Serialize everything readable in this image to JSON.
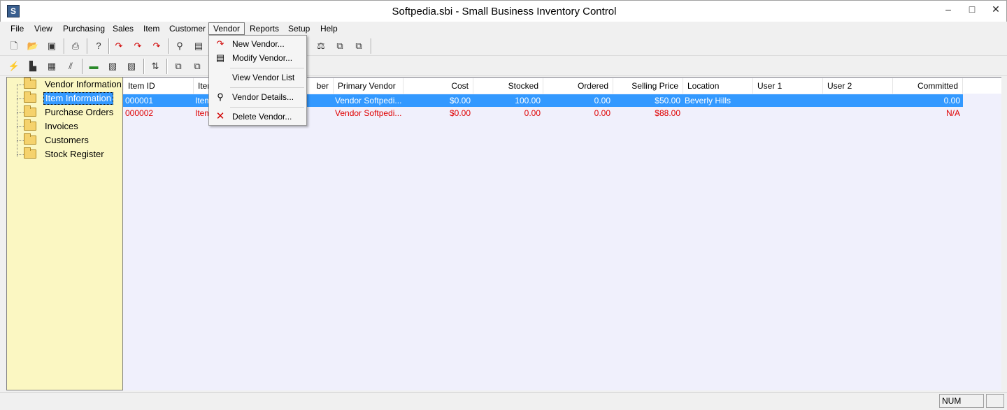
{
  "window": {
    "title": "Softpedia.sbi - Small Business Inventory Control",
    "app_icon": "S"
  },
  "window_controls": {
    "minimize": "–",
    "maximize": "□",
    "close": "✕"
  },
  "menubar": [
    "File",
    "View",
    "Purchasing",
    "Sales",
    "Item",
    "Customer",
    "Vendor",
    "Reports",
    "Setup",
    "Help"
  ],
  "toolbar1_icons": [
    "new-file-icon",
    "open-folder-icon",
    "open-db-icon",
    "print-icon",
    "help-icon",
    "receive-icon",
    "ship-icon",
    "return-icon",
    "find-icon",
    "report-icon",
    "scale-icon",
    "copy-icon",
    "copy-back-icon"
  ],
  "toolbar2_icons": [
    "bolt-icon",
    "truck-icon",
    "item-icon",
    "hatch-icon",
    "cash-icon",
    "adjust-icon",
    "transfer-icon",
    "sort-icon",
    "list-icon",
    "list-alt-icon"
  ],
  "tree": {
    "items": [
      {
        "label": "Vendor Information"
      },
      {
        "label": "Item Information"
      },
      {
        "label": "Purchase Orders"
      },
      {
        "label": "Invoices"
      },
      {
        "label": "Customers"
      },
      {
        "label": "Stock Register"
      }
    ],
    "selected": "Item Information"
  },
  "list": {
    "headers": [
      "Item ID",
      "Iter",
      "ber",
      "Primary Vendor",
      "Cost",
      "Stocked",
      "Ordered",
      "Selling Price",
      "Location",
      "User 1",
      "User 2",
      "Committed"
    ],
    "rows": [
      {
        "item_id": "000001",
        "item": "Item",
        "primary_vendor": "Vendor Softpedi...",
        "cost": "$0.00",
        "stocked": "100.00",
        "ordered": "0.00",
        "selling_price": "$50.00",
        "location": "Beverly Hills",
        "user1": "",
        "user2": "",
        "committed": "0.00"
      },
      {
        "item_id": "000002",
        "item": "Item",
        "primary_vendor": "Vendor Softpedi...",
        "cost": "$0.00",
        "stocked": "0.00",
        "ordered": "0.00",
        "selling_price": "$88.00",
        "location": "",
        "user1": "",
        "user2": "",
        "committed": "N/A"
      }
    ]
  },
  "vendor_menu": {
    "items": [
      {
        "label": "New Vendor...",
        "icon": "new-vendor-icon"
      },
      {
        "label": "Modify Vendor...",
        "icon": "modify-vendor-icon"
      },
      {
        "label": "View Vendor List",
        "icon": ""
      },
      {
        "label": "Vendor Details...",
        "icon": "vendor-details-icon"
      },
      {
        "label": "Delete Vendor...",
        "icon": "delete-vendor-icon"
      }
    ]
  },
  "statusbar": {
    "num": "NUM"
  },
  "colors": {
    "selection": "#3399ff",
    "red_text": "#e00000",
    "tree_bg": "#fbf7c2",
    "list_bg": "#f0f0fc"
  }
}
